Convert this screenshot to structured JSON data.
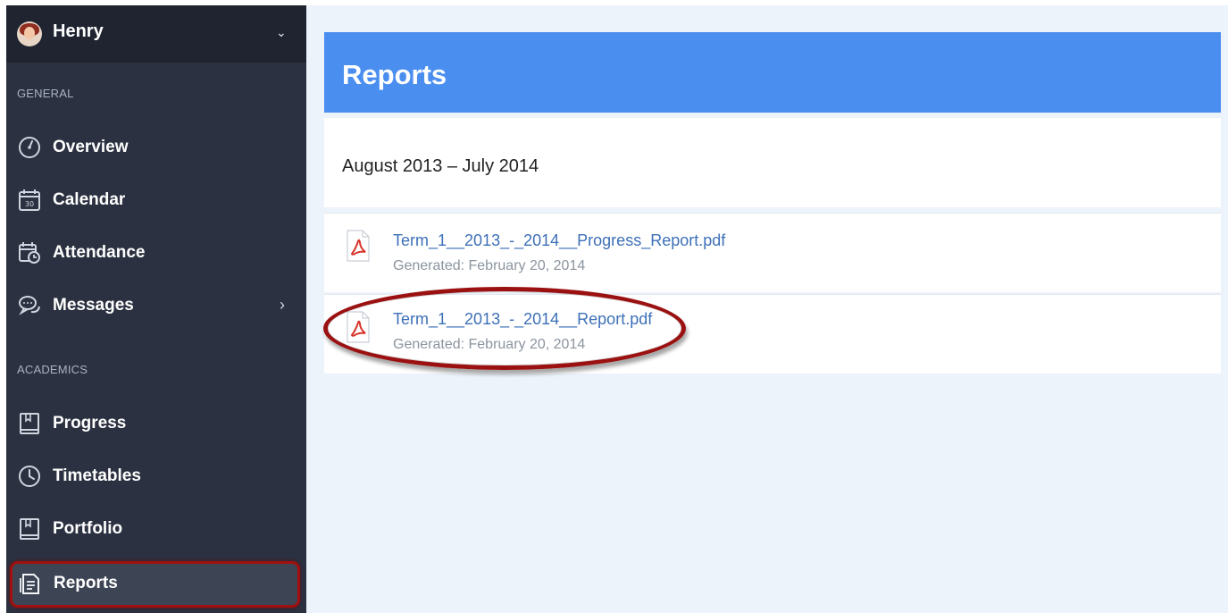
{
  "user": {
    "name": "Henry"
  },
  "sidebar": {
    "sections": [
      {
        "label": "GENERAL"
      },
      {
        "label": "ACADEMICS"
      }
    ],
    "items": [
      {
        "label": "Overview",
        "icon": "gauge-icon"
      },
      {
        "label": "Calendar",
        "icon": "calendar-icon",
        "icon_text": "30"
      },
      {
        "label": "Attendance",
        "icon": "attendance-icon"
      },
      {
        "label": "Messages",
        "icon": "chat-icon",
        "arrow": "›"
      },
      {
        "label": "Progress",
        "icon": "book-icon"
      },
      {
        "label": "Timetables",
        "icon": "clock-icon"
      },
      {
        "label": "Portfolio",
        "icon": "bookmark-icon"
      },
      {
        "label": "Reports",
        "icon": "reports-icon",
        "active": true
      }
    ]
  },
  "main": {
    "title": "Reports",
    "period": "August 2013 – July 2014",
    "reports": [
      {
        "file_name": "Term_1__2013_-_2014__Progress_Report.pdf",
        "generated": "Generated: February 20, 2014"
      },
      {
        "file_name": "Term_1__2013_-_2014__Report.pdf",
        "generated": "Generated: February 20, 2014"
      }
    ]
  },
  "colors": {
    "sidebar_bg": "#2b3140",
    "header_bg": "#4a8ef0",
    "link": "#3d70b7",
    "highlight": "#9b1111"
  }
}
